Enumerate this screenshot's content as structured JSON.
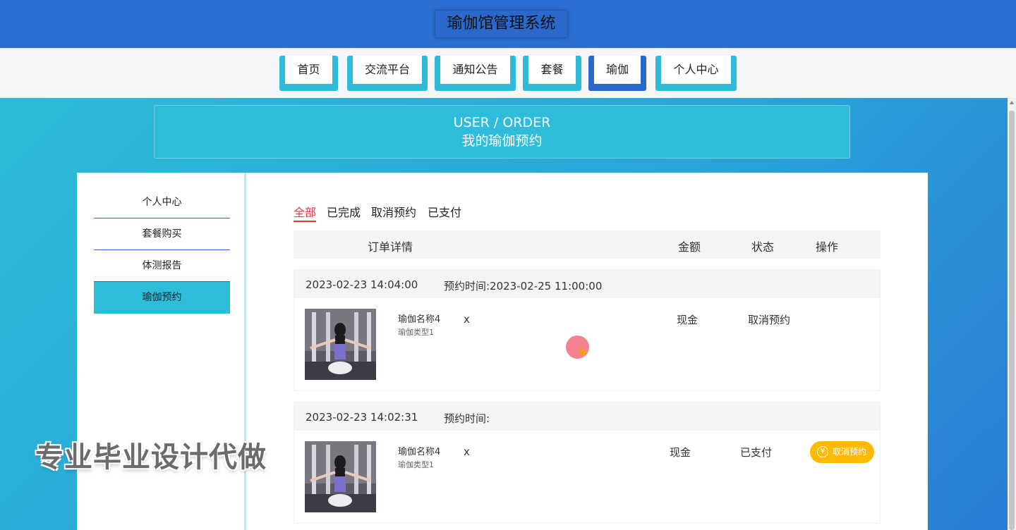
{
  "header": {
    "title": "瑜伽馆管理系统"
  },
  "nav": [
    {
      "label": "首页"
    },
    {
      "label": "交流平台"
    },
    {
      "label": "通知公告"
    },
    {
      "label": "套餐"
    },
    {
      "label": "瑜伽",
      "active": true
    },
    {
      "label": "个人中心"
    }
  ],
  "banner": {
    "en": "USER / ORDER",
    "cn": "我的瑜伽预约"
  },
  "sidebar": [
    {
      "label": "个人中心"
    },
    {
      "label": "套餐购买"
    },
    {
      "label": "体测报告"
    },
    {
      "label": "瑜伽预约",
      "active": true
    }
  ],
  "tabs": [
    {
      "label": "全部",
      "active": true
    },
    {
      "label": "已完成"
    },
    {
      "label": "取消预约"
    },
    {
      "label": "已支付"
    }
  ],
  "table_header": {
    "detail": "订单详情",
    "amount": "金额",
    "status": "状态",
    "action": "操作"
  },
  "orders": [
    {
      "created": "2023-02-23 14:04:00",
      "booking": "预约时间:2023-02-25 11:00:00",
      "name": "瑜伽名称4",
      "type": "瑜伽类型1",
      "qty": "x",
      "amount": "现金",
      "status": "取消预约",
      "action": ""
    },
    {
      "created": "2023-02-23 14:02:31",
      "booking": "预约时间:",
      "name": "瑜伽名称4",
      "type": "瑜伽类型1",
      "qty": "x",
      "amount": "现金",
      "status": "已支付",
      "action": "取消预约"
    }
  ],
  "watermark": "专业毕业设计代做",
  "colors": {
    "header": "#2b6fd3",
    "accent": "#2dbcda",
    "nav_active": "#2a69cc",
    "tab_active": "#e0383e",
    "button": "#ffba00"
  },
  "icons": {
    "cancel_button": "yen-icon"
  }
}
